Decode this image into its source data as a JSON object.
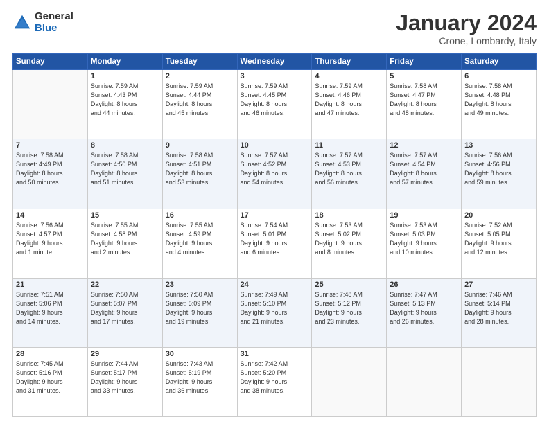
{
  "header": {
    "logo_general": "General",
    "logo_blue": "Blue",
    "title": "January 2024",
    "location": "Crone, Lombardy, Italy"
  },
  "days_of_week": [
    "Sunday",
    "Monday",
    "Tuesday",
    "Wednesday",
    "Thursday",
    "Friday",
    "Saturday"
  ],
  "weeks": [
    {
      "days": [
        {
          "num": "",
          "info": ""
        },
        {
          "num": "1",
          "info": "Sunrise: 7:59 AM\nSunset: 4:43 PM\nDaylight: 8 hours\nand 44 minutes."
        },
        {
          "num": "2",
          "info": "Sunrise: 7:59 AM\nSunset: 4:44 PM\nDaylight: 8 hours\nand 45 minutes."
        },
        {
          "num": "3",
          "info": "Sunrise: 7:59 AM\nSunset: 4:45 PM\nDaylight: 8 hours\nand 46 minutes."
        },
        {
          "num": "4",
          "info": "Sunrise: 7:59 AM\nSunset: 4:46 PM\nDaylight: 8 hours\nand 47 minutes."
        },
        {
          "num": "5",
          "info": "Sunrise: 7:58 AM\nSunset: 4:47 PM\nDaylight: 8 hours\nand 48 minutes."
        },
        {
          "num": "6",
          "info": "Sunrise: 7:58 AM\nSunset: 4:48 PM\nDaylight: 8 hours\nand 49 minutes."
        }
      ]
    },
    {
      "days": [
        {
          "num": "7",
          "info": "Sunrise: 7:58 AM\nSunset: 4:49 PM\nDaylight: 8 hours\nand 50 minutes."
        },
        {
          "num": "8",
          "info": "Sunrise: 7:58 AM\nSunset: 4:50 PM\nDaylight: 8 hours\nand 51 minutes."
        },
        {
          "num": "9",
          "info": "Sunrise: 7:58 AM\nSunset: 4:51 PM\nDaylight: 8 hours\nand 53 minutes."
        },
        {
          "num": "10",
          "info": "Sunrise: 7:57 AM\nSunset: 4:52 PM\nDaylight: 8 hours\nand 54 minutes."
        },
        {
          "num": "11",
          "info": "Sunrise: 7:57 AM\nSunset: 4:53 PM\nDaylight: 8 hours\nand 56 minutes."
        },
        {
          "num": "12",
          "info": "Sunrise: 7:57 AM\nSunset: 4:54 PM\nDaylight: 8 hours\nand 57 minutes."
        },
        {
          "num": "13",
          "info": "Sunrise: 7:56 AM\nSunset: 4:56 PM\nDaylight: 8 hours\nand 59 minutes."
        }
      ]
    },
    {
      "days": [
        {
          "num": "14",
          "info": "Sunrise: 7:56 AM\nSunset: 4:57 PM\nDaylight: 9 hours\nand 1 minute."
        },
        {
          "num": "15",
          "info": "Sunrise: 7:55 AM\nSunset: 4:58 PM\nDaylight: 9 hours\nand 2 minutes."
        },
        {
          "num": "16",
          "info": "Sunrise: 7:55 AM\nSunset: 4:59 PM\nDaylight: 9 hours\nand 4 minutes."
        },
        {
          "num": "17",
          "info": "Sunrise: 7:54 AM\nSunset: 5:01 PM\nDaylight: 9 hours\nand 6 minutes."
        },
        {
          "num": "18",
          "info": "Sunrise: 7:53 AM\nSunset: 5:02 PM\nDaylight: 9 hours\nand 8 minutes."
        },
        {
          "num": "19",
          "info": "Sunrise: 7:53 AM\nSunset: 5:03 PM\nDaylight: 9 hours\nand 10 minutes."
        },
        {
          "num": "20",
          "info": "Sunrise: 7:52 AM\nSunset: 5:05 PM\nDaylight: 9 hours\nand 12 minutes."
        }
      ]
    },
    {
      "days": [
        {
          "num": "21",
          "info": "Sunrise: 7:51 AM\nSunset: 5:06 PM\nDaylight: 9 hours\nand 14 minutes."
        },
        {
          "num": "22",
          "info": "Sunrise: 7:50 AM\nSunset: 5:07 PM\nDaylight: 9 hours\nand 17 minutes."
        },
        {
          "num": "23",
          "info": "Sunrise: 7:50 AM\nSunset: 5:09 PM\nDaylight: 9 hours\nand 19 minutes."
        },
        {
          "num": "24",
          "info": "Sunrise: 7:49 AM\nSunset: 5:10 PM\nDaylight: 9 hours\nand 21 minutes."
        },
        {
          "num": "25",
          "info": "Sunrise: 7:48 AM\nSunset: 5:12 PM\nDaylight: 9 hours\nand 23 minutes."
        },
        {
          "num": "26",
          "info": "Sunrise: 7:47 AM\nSunset: 5:13 PM\nDaylight: 9 hours\nand 26 minutes."
        },
        {
          "num": "27",
          "info": "Sunrise: 7:46 AM\nSunset: 5:14 PM\nDaylight: 9 hours\nand 28 minutes."
        }
      ]
    },
    {
      "days": [
        {
          "num": "28",
          "info": "Sunrise: 7:45 AM\nSunset: 5:16 PM\nDaylight: 9 hours\nand 31 minutes."
        },
        {
          "num": "29",
          "info": "Sunrise: 7:44 AM\nSunset: 5:17 PM\nDaylight: 9 hours\nand 33 minutes."
        },
        {
          "num": "30",
          "info": "Sunrise: 7:43 AM\nSunset: 5:19 PM\nDaylight: 9 hours\nand 36 minutes."
        },
        {
          "num": "31",
          "info": "Sunrise: 7:42 AM\nSunset: 5:20 PM\nDaylight: 9 hours\nand 38 minutes."
        },
        {
          "num": "",
          "info": ""
        },
        {
          "num": "",
          "info": ""
        },
        {
          "num": "",
          "info": ""
        }
      ]
    }
  ]
}
